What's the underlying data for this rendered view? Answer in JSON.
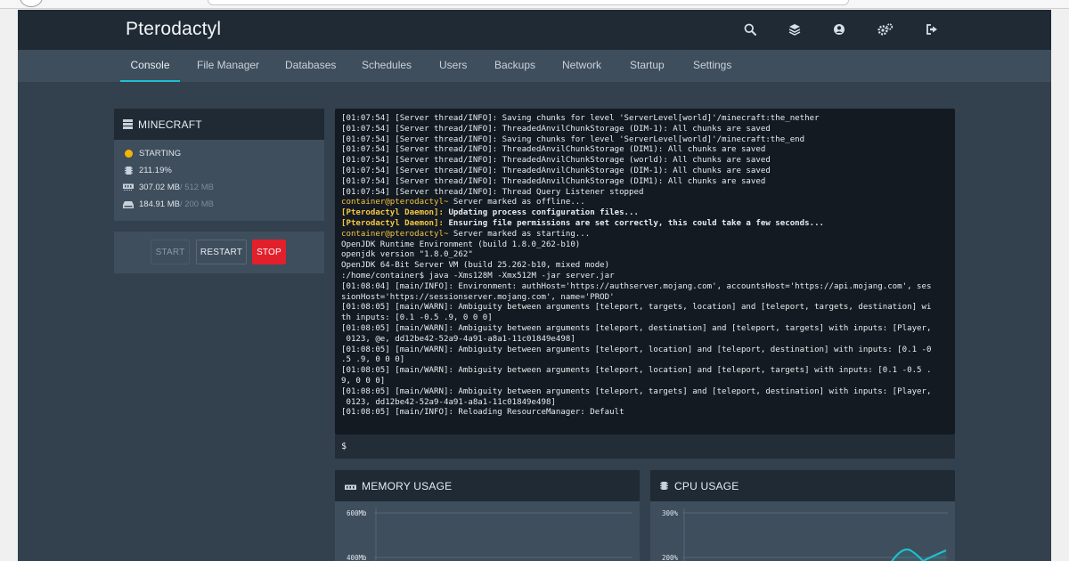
{
  "app": {
    "title": "Pterodactyl"
  },
  "header": {
    "icons": [
      "search-icon",
      "layers-icon",
      "account-icon",
      "settings-icon",
      "logout-icon"
    ]
  },
  "tabs": [
    {
      "label": "Console",
      "active": true
    },
    {
      "label": "File Manager"
    },
    {
      "label": "Databases"
    },
    {
      "label": "Schedules"
    },
    {
      "label": "Users"
    },
    {
      "label": "Backups"
    },
    {
      "label": "Network"
    },
    {
      "label": "Startup"
    },
    {
      "label": "Settings"
    }
  ],
  "server": {
    "name": "MINECRAFT",
    "status": "STARTING",
    "status_color": "#f5b400",
    "cpu": "211.19%",
    "memory_used": "307.02 MB",
    "memory_limit": " / 512 MB",
    "disk_used": "184.91 MB",
    "disk_limit": " / 200 MB"
  },
  "controls": {
    "start": "START",
    "restart": "RESTART",
    "stop": "STOP",
    "stop_color": "#e2202b"
  },
  "console": {
    "lines": [
      {
        "text": "[01:07:54] [Server thread/INFO]: Saving chunks for level 'ServerLevel[world]'/minecraft:the_nether"
      },
      {
        "text": "[01:07:54] [Server thread/INFO]: ThreadedAnvilChunkStorage (DIM-1): All chunks are saved"
      },
      {
        "text": "[01:07:54] [Server thread/INFO]: Saving chunks for level 'ServerLevel[world]'/minecraft:the_end"
      },
      {
        "text": "[01:07:54] [Server thread/INFO]: ThreadedAnvilChunkStorage (DIM1): All chunks are saved"
      },
      {
        "text": "[01:07:54] [Server thread/INFO]: ThreadedAnvilChunkStorage (world): All chunks are saved"
      },
      {
        "text": "[01:07:54] [Server thread/INFO]: ThreadedAnvilChunkStorage (DIM-1): All chunks are saved"
      },
      {
        "text": "[01:07:54] [Server thread/INFO]: ThreadedAnvilChunkStorage (DIM1): All chunks are saved"
      },
      {
        "text": "[01:07:54] [Server thread/INFO]: Thread Query Listener stopped"
      },
      {
        "prefix": "container@pterodactyl~",
        "text": " Server marked as offline..."
      },
      {
        "prefix": "[Pterodactyl Daemon]:",
        "text": " Updating process configuration files...",
        "bold": true
      },
      {
        "prefix": "[Pterodactyl Daemon]:",
        "text": " Ensuring file permissions are set correctly, this could take a few seconds...",
        "bold": true
      },
      {
        "prefix": "container@pterodactyl~",
        "text": " Server marked as starting..."
      },
      {
        "text": "OpenJDK Runtime Environment (build 1.8.0_262-b10)"
      },
      {
        "text": "openjdk version \"1.8.0_262\""
      },
      {
        "text": "OpenJDK 64-Bit Server VM (build 25.262-b10, mixed mode)"
      },
      {
        "text": ":/home/container$ java -Xms128M -Xmx512M -jar server.jar"
      },
      {
        "text": "[01:08:04] [main/INFO]: Environment: authHost='https://authserver.mojang.com', accountsHost='https://api.mojang.com', ses"
      },
      {
        "text": "sionHost='https://sessionserver.mojang.com', name='PROD'"
      },
      {
        "text": "[01:08:05] [main/WARN]: Ambiguity between arguments [teleport, targets, location] and [teleport, targets, destination] wi"
      },
      {
        "text": "th inputs: [0.1 -0.5 .9, 0 0 0]"
      },
      {
        "text": "[01:08:05] [main/WARN]: Ambiguity between arguments [teleport, destination] and [teleport, targets] with inputs: [Player,"
      },
      {
        "text": " 0123, @e, dd12be42-52a9-4a91-a8a1-11c01849e498]"
      },
      {
        "text": "[01:08:05] [main/WARN]: Ambiguity between arguments [teleport, location] and [teleport, destination] with inputs: [0.1 -0"
      },
      {
        "text": ".5 .9, 0 0 0]"
      },
      {
        "text": "[01:08:05] [main/WARN]: Ambiguity between arguments [teleport, location] and [teleport, targets] with inputs: [0.1 -0.5 ."
      },
      {
        "text": "9, 0 0 0]"
      },
      {
        "text": "[01:08:05] [main/WARN]: Ambiguity between arguments [teleport, targets] and [teleport, destination] with inputs: [Player,"
      },
      {
        "text": " 0123, dd12be42-52a9-4a91-a8a1-11c01849e498]"
      },
      {
        "text": "[01:08:05] [main/INFO]: Reloading ResourceManager: Default"
      }
    ],
    "prompt": "$"
  },
  "charts": {
    "memory": {
      "title": "MEMORY USAGE",
      "y_ticks": [
        "600Mb",
        "400Mb"
      ]
    },
    "cpu": {
      "title": "CPU USAGE",
      "y_ticks": [
        "300%",
        "200%"
      ],
      "line_color": "#1dc1ce"
    }
  }
}
